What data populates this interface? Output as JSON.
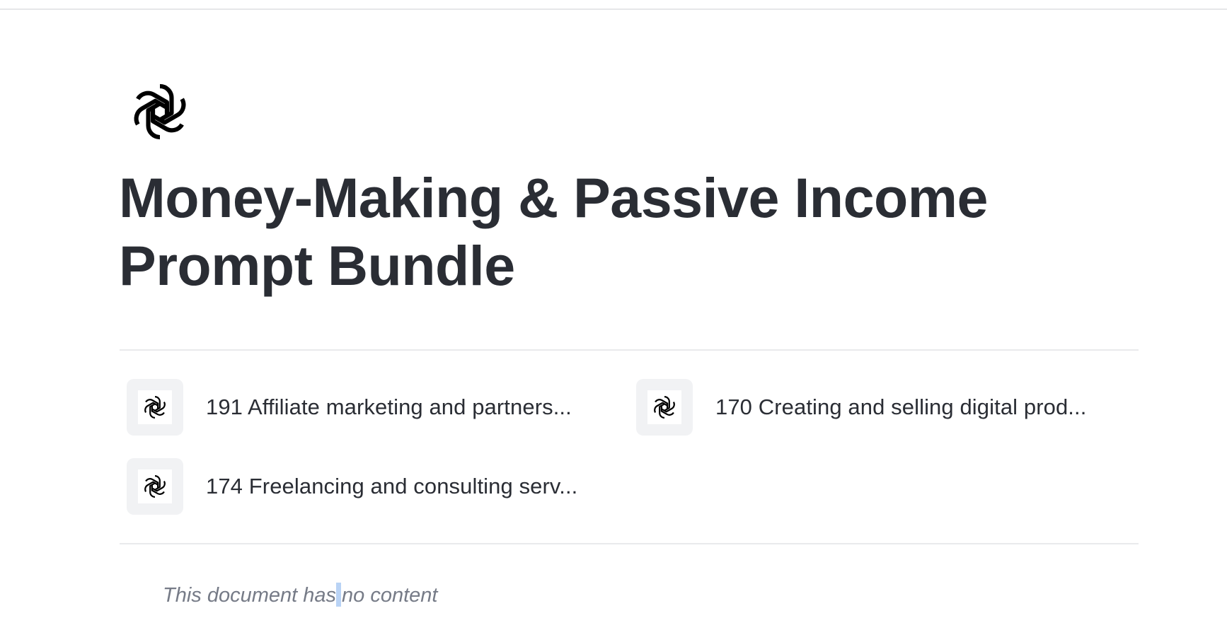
{
  "document": {
    "icon": "openai-logo-icon",
    "title": "Money-Making & Passive Income Prompt Bundle"
  },
  "subpages": [
    {
      "icon": "openai-logo-icon",
      "label": "191 Affiliate marketing and partners..."
    },
    {
      "icon": "openai-logo-icon",
      "label": "170 Creating and selling digital prod..."
    },
    {
      "icon": "openai-logo-icon",
      "label": "174 Freelancing and consulting serv..."
    }
  ],
  "empty_state": {
    "text_before_caret": "This document has",
    "text_after_caret": "no content"
  },
  "colors": {
    "text": "#2a2d34",
    "muted_text": "#767b87",
    "divider": "#e9eaec",
    "tile_bg": "#f1f2f4",
    "selection": "#b9d3f5"
  }
}
